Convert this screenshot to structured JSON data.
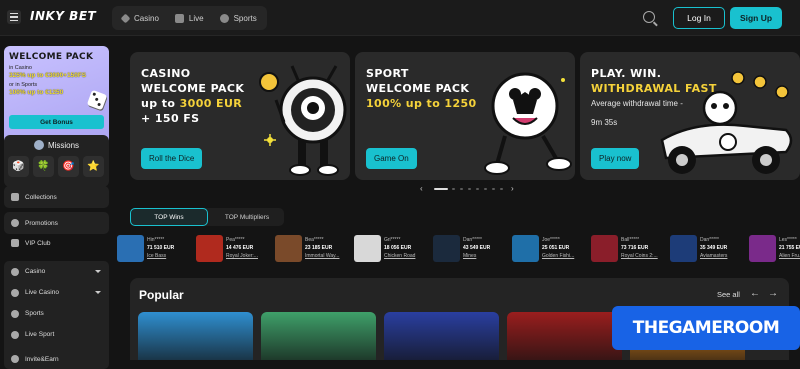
{
  "header": {
    "logo_text": "INKY BET",
    "nav": [
      {
        "label": "Casino",
        "icon": "diamond-icon"
      },
      {
        "label": "Live",
        "icon": "live-icon"
      },
      {
        "label": "Sports",
        "icon": "ball-icon"
      }
    ],
    "login_label": "Log In",
    "signup_label": "Sign Up"
  },
  "sidebar": {
    "welcome": {
      "title": "WELCOME PACK",
      "casino_label": "in Casino",
      "casino_offer": "325% up to €3000+150FS",
      "sports_label": "or in Sports",
      "sports_offer": "100% up to €1250",
      "button_label": "Get Bonus"
    },
    "missions_label": "Missions",
    "mission_icons": [
      "🎲",
      "🍀",
      "🎯",
      "⭐"
    ],
    "items": [
      {
        "label": "Collections",
        "icon": "collections-icon"
      },
      {
        "label": "Promotions",
        "icon": "promotions-icon"
      },
      {
        "label": "VIP Club",
        "icon": "crown-icon"
      }
    ],
    "group": [
      {
        "label": "Casino",
        "icon": "casino-icon",
        "expandable": true
      },
      {
        "label": "Live Casino",
        "icon": "live-casino-icon",
        "expandable": true
      },
      {
        "label": "Sports",
        "icon": "sports-icon",
        "expandable": false
      },
      {
        "label": "Live Sport",
        "icon": "live-sport-icon",
        "expandable": false
      }
    ],
    "invite_label": "Invite&Earn"
  },
  "banners": [
    {
      "line1": "CASINO",
      "line2": "WELCOME PACK",
      "line3_pre": "up to ",
      "line3_hl": "3000 EUR",
      "line4": "+ 150 FS",
      "button": "Roll the Dice"
    },
    {
      "line1": "SPORT",
      "line2": "WELCOME PACK",
      "line3_hl": "100% up to 1250",
      "button": "Game On"
    },
    {
      "line1": "PLAY. WIN.",
      "line2_hl": "WITHDRAWAL FAST",
      "line3": "Average withdrawal time -",
      "line4": "9m 35s",
      "button": "Play now"
    }
  ],
  "tabs": [
    "TOP Wins",
    "TOP Multipliers"
  ],
  "wins": [
    {
      "user": "Hin*****",
      "amount": "71 510 EUR",
      "game": "Ice Bass",
      "color": "#2a6fb3"
    },
    {
      "user": "Pea*****",
      "amount": "14 476 EUR",
      "game": "Royal Joker:...",
      "color": "#b02a1e"
    },
    {
      "user": "Bea*****",
      "amount": "23 185 EUR",
      "game": "Immortal Way...",
      "color": "#7a4a2a"
    },
    {
      "user": "Gri*****",
      "amount": "18 056 EUR",
      "game": "Chicken Road",
      "color": "#d8d8d8"
    },
    {
      "user": "Dan*****",
      "amount": "43 549 EUR",
      "game": "Mines",
      "color": "#1b2a3d"
    },
    {
      "user": "Joe*****",
      "amount": "25 051 EUR",
      "game": "Golden Fishi...",
      "color": "#1f6fa8"
    },
    {
      "user": "Ball*****",
      "amount": "73 716 EUR",
      "game": "Royal Coins 2:...",
      "color": "#8a1e2a"
    },
    {
      "user": "Dan*****",
      "amount": "35 349 EUR",
      "game": "Aviamasters",
      "color": "#1d3c78"
    },
    {
      "user": "Les*****",
      "amount": "21 755 EUR",
      "game": "Alien Fru...",
      "color": "#7a2a8a"
    }
  ],
  "popular": {
    "title": "Popular",
    "see_all": "See all",
    "cards": [
      "#2f8fd0",
      "#3fa06a",
      "#2a3fa0",
      "#9a1e1e",
      "#e88a1e"
    ]
  },
  "watermark": "THEGAMEROOM",
  "colors": {
    "accent": "#19c1cf",
    "highlight": "#f5d23a",
    "background": "#141414"
  }
}
